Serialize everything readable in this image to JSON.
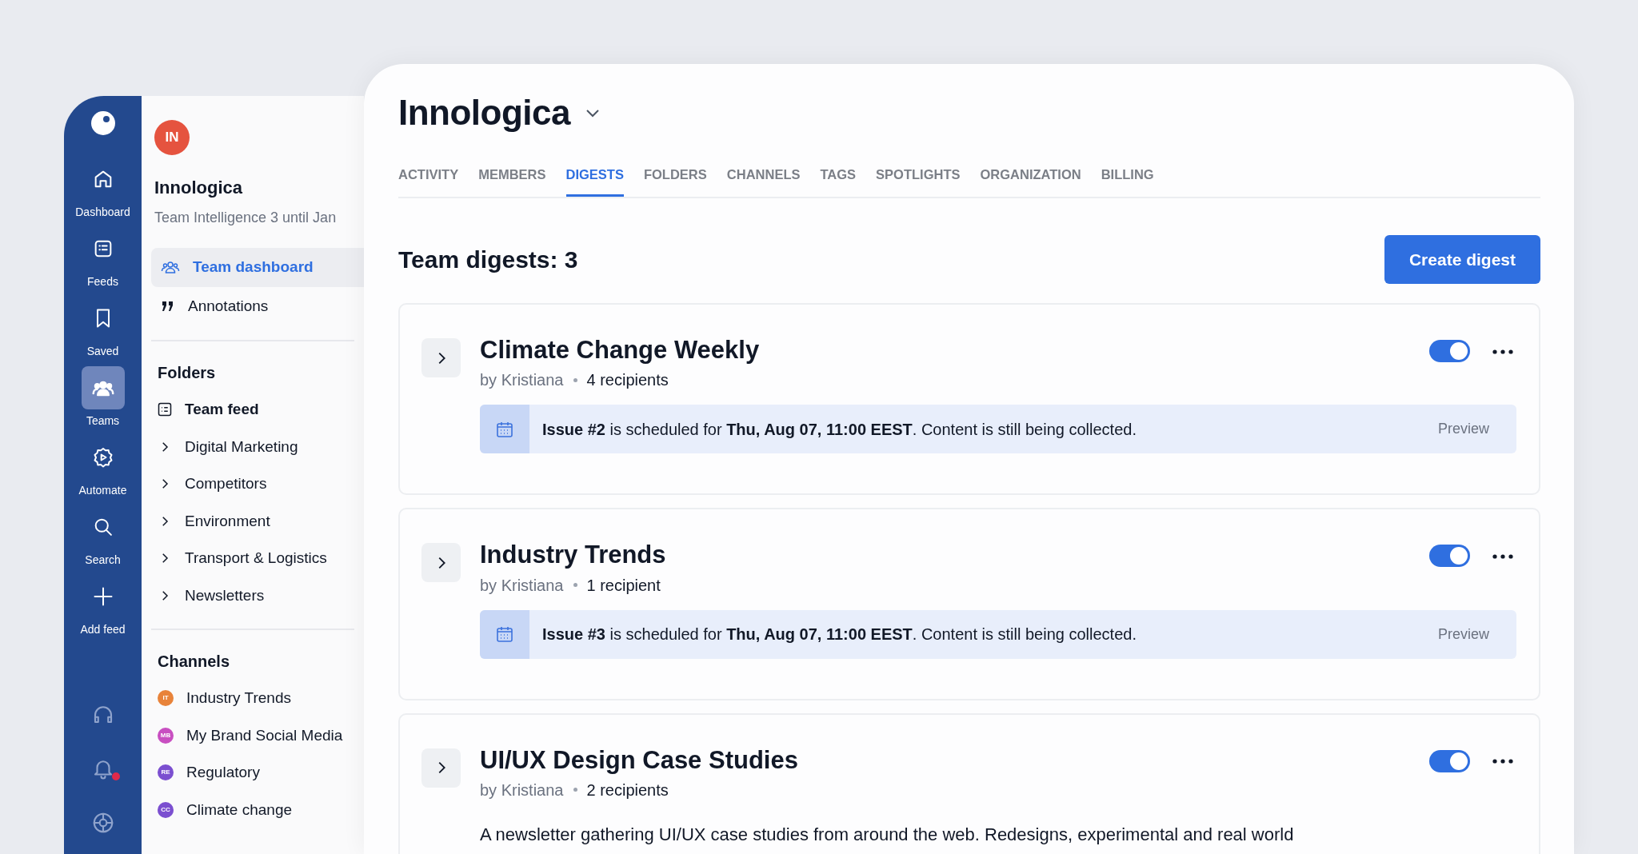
{
  "rail": {
    "items": [
      {
        "label": "Dashboard",
        "selected": false
      },
      {
        "label": "Feeds",
        "selected": false
      },
      {
        "label": "Saved",
        "selected": false
      },
      {
        "label": "Teams",
        "selected": true
      },
      {
        "label": "Automate",
        "selected": false
      },
      {
        "label": "Search",
        "selected": false
      },
      {
        "label": "Add feed",
        "selected": false
      }
    ],
    "bottom": [
      {
        "kind": "support",
        "unread": false
      },
      {
        "kind": "notifications",
        "unread": true
      },
      {
        "kind": "help",
        "unread": false
      }
    ]
  },
  "sidebar": {
    "avatar": "IN",
    "team": "Innologica",
    "plan": "Team Intelligence 3 until Jan",
    "nav": [
      {
        "label": "Team dashboard",
        "selected": true
      },
      {
        "label": "Annotations",
        "selected": false
      }
    ],
    "folders_title": "Folders",
    "folders": [
      {
        "kind": "feed",
        "label": "Team feed"
      },
      {
        "kind": "folder",
        "label": "Digital Marketing"
      },
      {
        "kind": "folder",
        "label": "Competitors"
      },
      {
        "kind": "folder",
        "label": "Environment"
      },
      {
        "kind": "folder",
        "label": "Transport & Logistics"
      },
      {
        "kind": "folder",
        "label": "Newsletters"
      }
    ],
    "channels_title": "Channels",
    "channels": [
      {
        "initials": "IT",
        "label": "Industry Trends",
        "color": "#e8833a"
      },
      {
        "initials": "MB",
        "label": "My Brand Social Media",
        "color": "#c84fc1"
      },
      {
        "initials": "RE",
        "label": "Regulatory",
        "color": "#7b4fd0"
      },
      {
        "initials": "CC",
        "label": "Climate change",
        "color": "#7b4fd0"
      }
    ]
  },
  "main": {
    "title": "Innologica",
    "tabs": [
      {
        "label": "ACTIVITY",
        "selected": false
      },
      {
        "label": "MEMBERS",
        "selected": false
      },
      {
        "label": "DIGESTS",
        "selected": true
      },
      {
        "label": "FOLDERS",
        "selected": false
      },
      {
        "label": "CHANNELS",
        "selected": false
      },
      {
        "label": "TAGS",
        "selected": false
      },
      {
        "label": "SPOTLIGHTS",
        "selected": false
      },
      {
        "label": "ORGANIZATION",
        "selected": false
      },
      {
        "label": "BILLING",
        "selected": false
      }
    ],
    "heading": "Team digests: 3",
    "create_button": "Create digest",
    "digests": [
      {
        "title": "Climate Change Weekly",
        "author": "by Kristiana",
        "recipients": "4 recipients",
        "on": true,
        "notice": "**Issue #2** is scheduled for **Thu, Aug 07, 11:00 EEST**. Content is still being collected.",
        "preview": "Preview"
      },
      {
        "title": "Industry Trends",
        "author": "by Kristiana",
        "recipients": "1 recipient",
        "on": true,
        "notice": "**Issue #3** is scheduled for **Thu, Aug 07, 11:00 EEST**. Content is still being collected.",
        "preview": "Preview"
      },
      {
        "title": "UI/UX Design Case Studies",
        "author": "by Kristiana",
        "recipients": "2 recipients",
        "on": true,
        "description": "A newsletter gathering UI/UX case studies from around the web. Redesigns, experimental and real world"
      }
    ]
  }
}
